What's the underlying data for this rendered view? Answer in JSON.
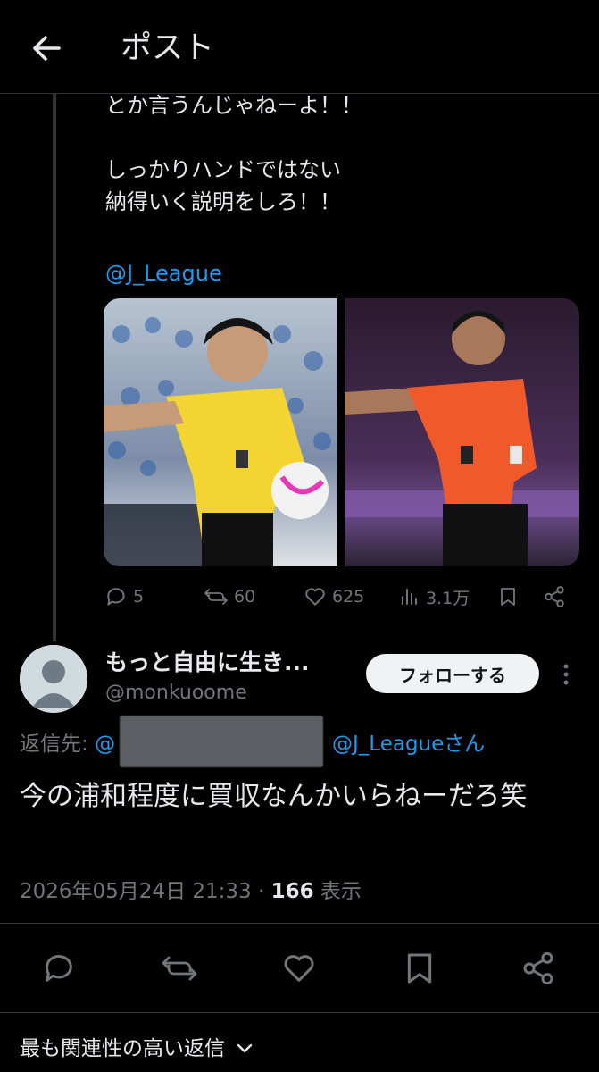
{
  "header": {
    "title": "ポスト",
    "back_icon": "arrow-left-icon"
  },
  "previous_post": {
    "lines": [
      "とか言うんじゃねーよ！！",
      "",
      "しっかりハンドではない",
      "納得いく説明をしろ！！"
    ],
    "mention": "@J_League",
    "actions": {
      "replies": "5",
      "reposts": "60",
      "likes": "625",
      "views": "3.1万"
    }
  },
  "reply": {
    "name": "もっと自由に生き...",
    "handle": "@monkuoome",
    "follow_label": "フォローする",
    "replying_prefix": "返信先: ",
    "replying_at": "@",
    "replying_mention": "@J_Leagueさん",
    "text": "今の浦和程度に買収なんかいらねーだろ笑",
    "timestamp": "2026年05月24日 21:33 · ",
    "views_count": "166",
    "views_label": " 表示"
  },
  "footer": {
    "sort_label": "最も関連性の高い返信"
  },
  "colors": {
    "accent": "#1d9bf0",
    "muted": "#71767b",
    "background": "#000000"
  }
}
